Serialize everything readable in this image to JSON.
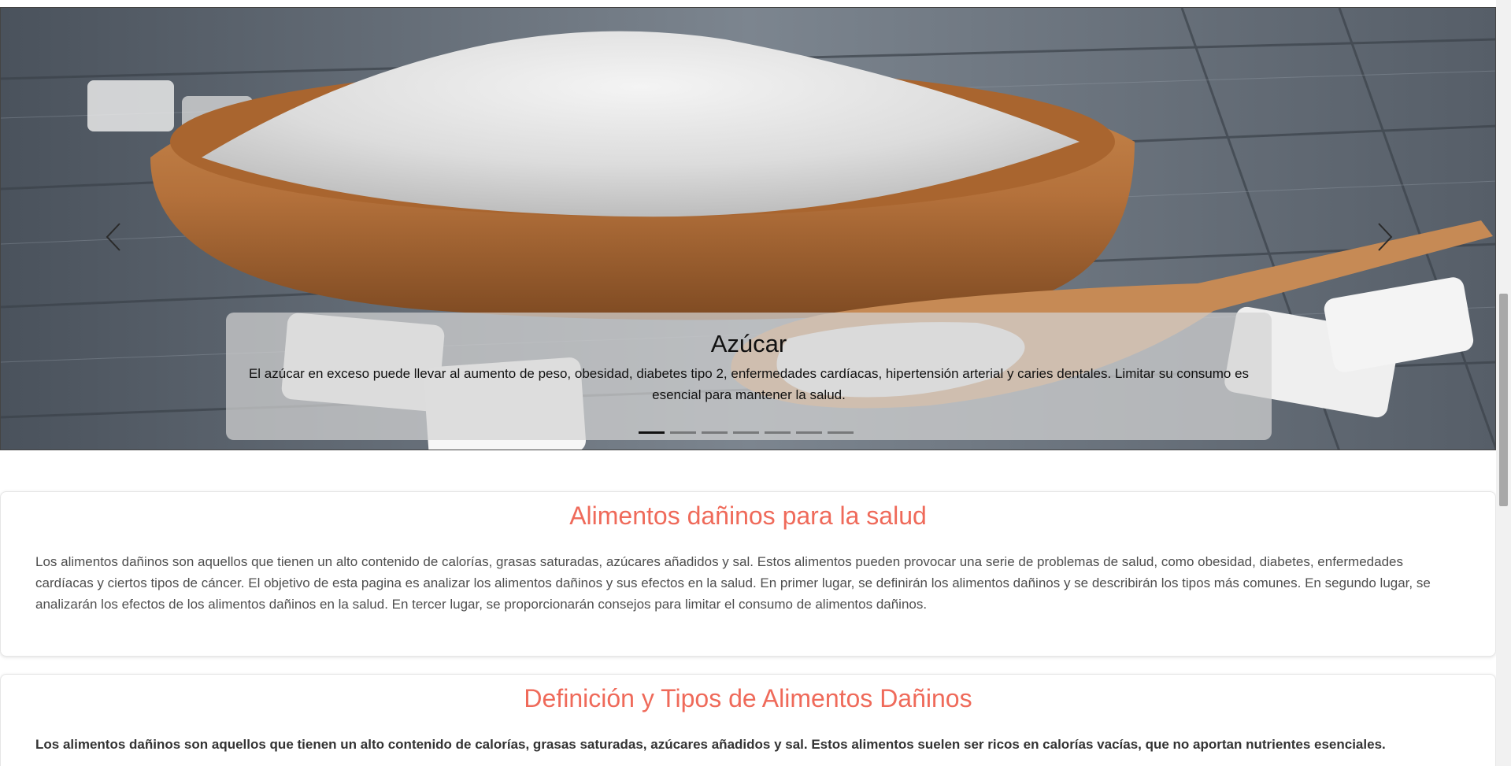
{
  "carousel": {
    "slide_title": "Azúcar",
    "slide_text": "El azúcar en exceso puede llevar al aumento de peso, obesidad, diabetes tipo 2, enfermedades cardíacas, hipertensión arterial y caries dentales. Limitar su consumo es esencial para mantener la salud.",
    "indicator_count": 7,
    "active_index": 0,
    "prev_icon": "chevron-left-icon",
    "next_icon": "chevron-right-icon"
  },
  "sections": [
    {
      "title": "Alimentos dañinos para la salud",
      "text": "Los alimentos dañinos son aquellos que tienen un alto contenido de calorías, grasas saturadas, azúcares añadidos y sal. Estos alimentos pueden provocar una serie de problemas de salud, como obesidad, diabetes, enfermedades cardíacas y ciertos tipos de cáncer. El objetivo de esta pagina es analizar los alimentos dañinos y sus efectos en la salud. En primer lugar, se definirán los alimentos dañinos y se describirán los tipos más comunes. En segundo lugar, se analizarán los efectos de los alimentos dañinos en la salud. En tercer lugar, se proporcionarán consejos para limitar el consumo de alimentos dañinos."
    },
    {
      "title": "Definición y Tipos de Alimentos Dañinos",
      "text": "Los alimentos dañinos son aquellos que tienen un alto contenido de calorías, grasas saturadas, azúcares añadidos y sal. Estos alimentos suelen ser ricos en calorías vacías, que no aportan nutrientes esenciales."
    }
  ],
  "colors": {
    "heading": "#ef6a5a",
    "caption_bg": "#d2d2d2"
  },
  "scroll": {
    "position_fraction": 0.48
  }
}
